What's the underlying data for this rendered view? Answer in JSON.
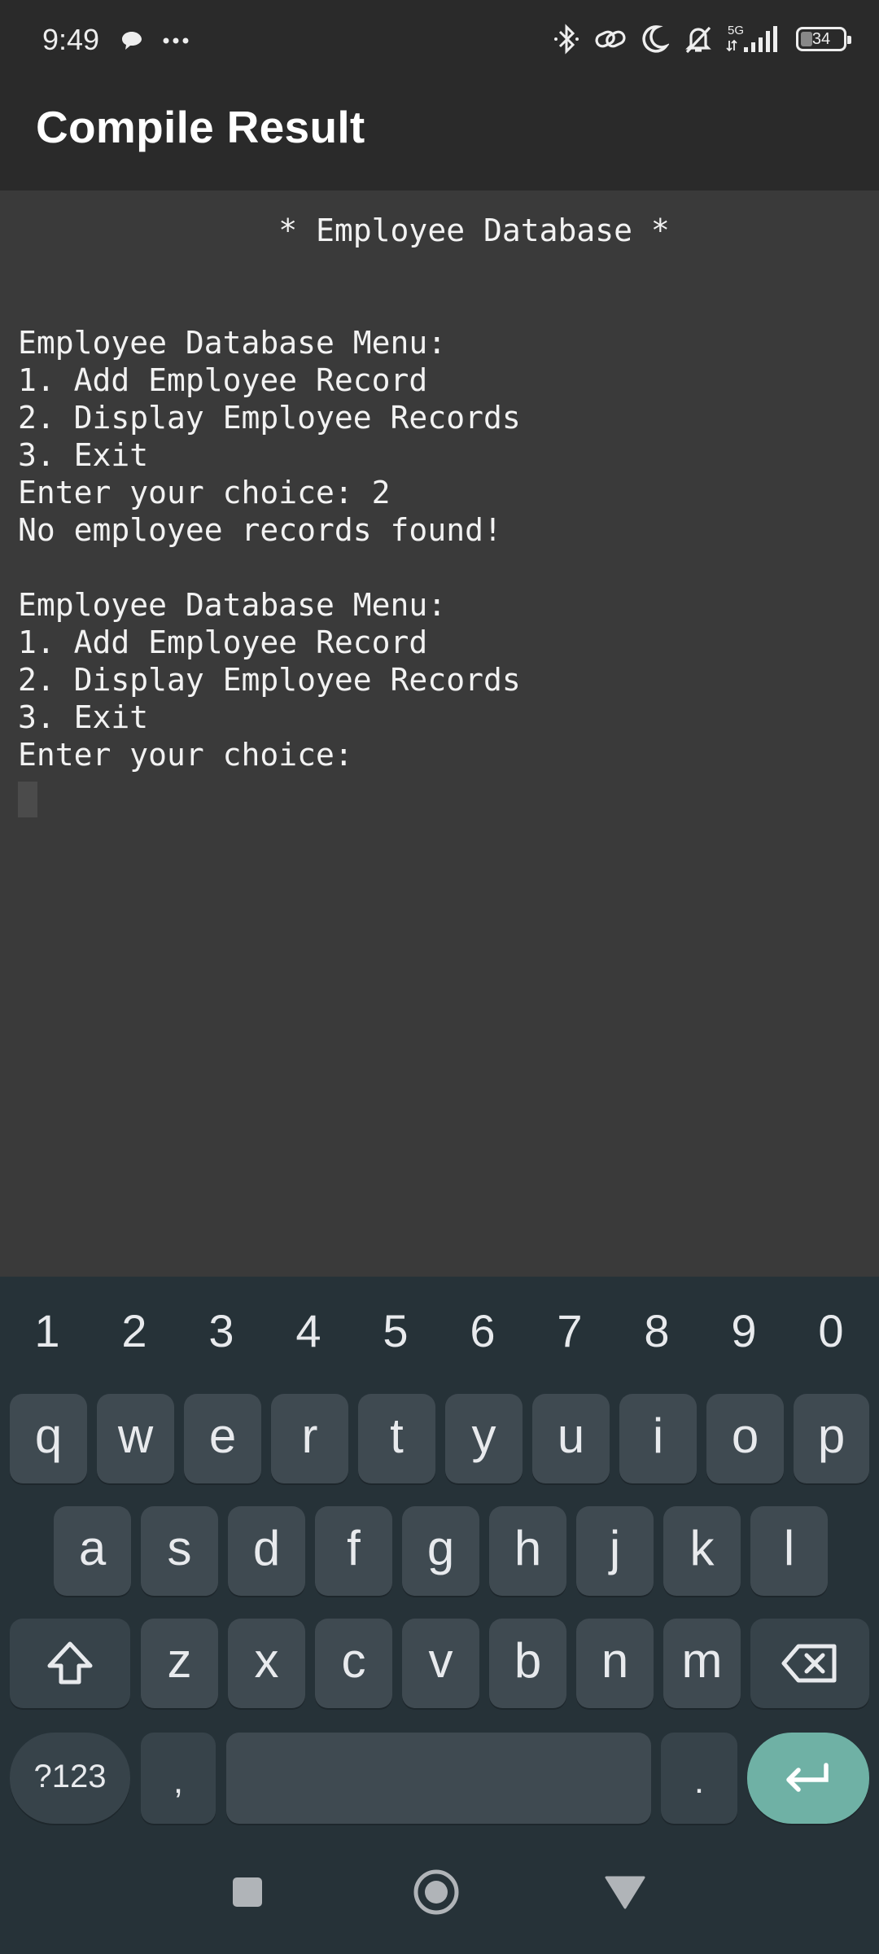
{
  "status_bar": {
    "time": "9:49",
    "network_type": "5G",
    "battery_level": "34",
    "icons": [
      "chat-bubble-icon",
      "more-dots-icon",
      "bluetooth-icon",
      "link-icon",
      "moon-icon",
      "bell-off-icon",
      "signal-icon",
      "battery-icon"
    ]
  },
  "app_bar": {
    "title": "Compile Result"
  },
  "console": {
    "output": "              * Employee Database *\n\n\nEmployee Database Menu:\n1. Add Employee Record\n2. Display Employee Records\n3. Exit\nEnter your choice: 2\nNo employee records found!\n\nEmployee Database Menu:\n1. Add Employee Record\n2. Display Employee Records\n3. Exit\nEnter your choice: "
  },
  "keyboard": {
    "numbers": [
      "1",
      "2",
      "3",
      "4",
      "5",
      "6",
      "7",
      "8",
      "9",
      "0"
    ],
    "row1": [
      "q",
      "w",
      "e",
      "r",
      "t",
      "y",
      "u",
      "i",
      "o",
      "p"
    ],
    "row2": [
      "a",
      "s",
      "d",
      "f",
      "g",
      "h",
      "j",
      "k",
      "l"
    ],
    "row3": [
      "z",
      "x",
      "c",
      "v",
      "b",
      "n",
      "m"
    ],
    "symbols_label": "?123",
    "comma_label": ",",
    "period_label": ".",
    "shift_icon": "shift-arrow-icon",
    "backspace_icon": "backspace-icon",
    "enter_icon": "enter-return-icon",
    "colors": {
      "background": "#263238",
      "key": "#3f4a51",
      "enter": "#6fb1a5"
    }
  },
  "nav_bar": {
    "icons": [
      "recents-square-icon",
      "home-circle-icon",
      "back-triangle-icon"
    ]
  }
}
